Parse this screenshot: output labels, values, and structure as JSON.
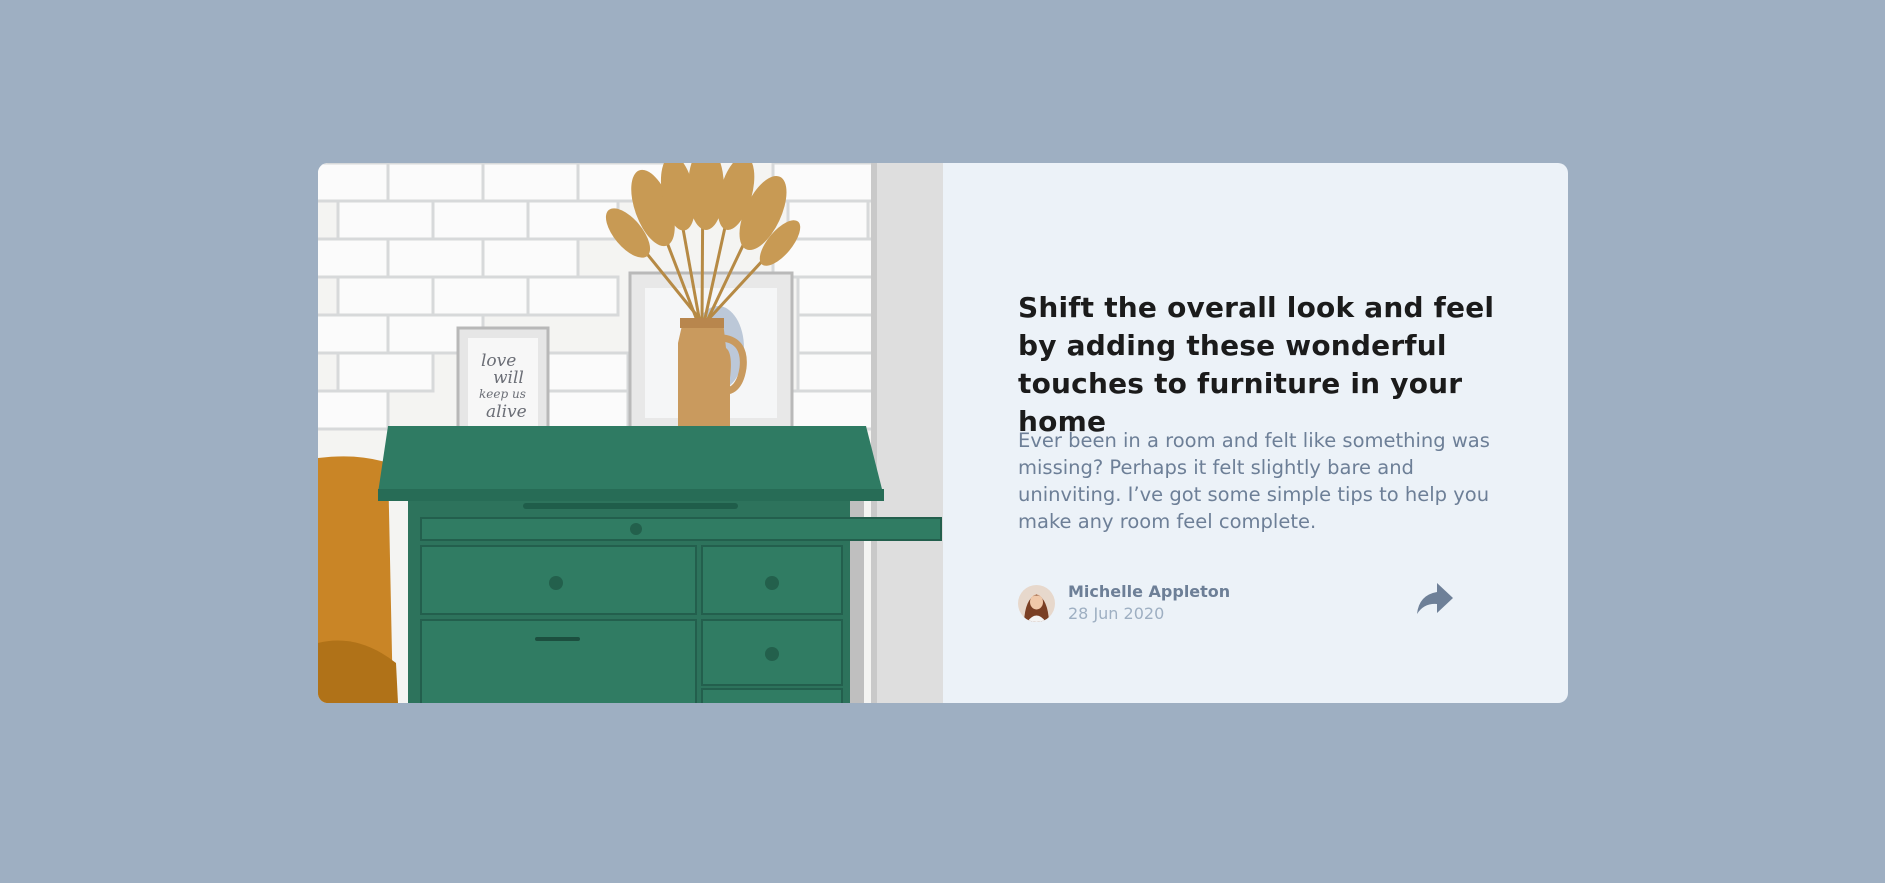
{
  "card": {
    "image_alt": "drawers",
    "title": "Shift the overall look and feel by adding these wonderful touches to furniture in your home",
    "description": "Ever been in a room and felt like something was missing? Perhaps it felt slightly bare and uninviting. I’ve got some simple tips to help you make any room feel complete.",
    "frame_text": [
      "love",
      "will",
      "keep us",
      "alive"
    ]
  },
  "author": {
    "name": "Michelle Appleton",
    "date": "28 Jun 2020",
    "avatar_icon": "avatar-portrait"
  },
  "share": {
    "icon": "share-arrow-icon"
  },
  "colors": {
    "page_background": "#9eafc2",
    "card_background": "#ecf2f8",
    "heading": "#1b1b1b",
    "body_text": "#6d7f97",
    "muted_text": "#9eafc2",
    "dresser_green": "#2f7b63"
  }
}
